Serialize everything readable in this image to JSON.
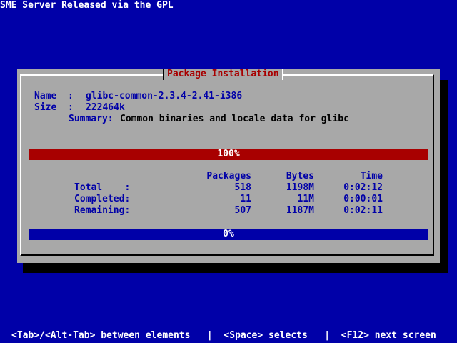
{
  "screen_title": "SME Server Released via the GPL",
  "dialog": {
    "title": "Package Installation",
    "name_label": "Name  :",
    "name_value": "glibc-common-2.3.4-2.41-i386",
    "size_label": "Size  :",
    "size_value": "222464k",
    "summary_label": "Summary:",
    "summary_value": "Common binaries and locale data for glibc",
    "package_progress": {
      "label": "100%",
      "fraction": 1.0
    },
    "stats": {
      "headers": [
        "Packages",
        "Bytes",
        "Time"
      ],
      "rows": [
        {
          "label": "Total    :",
          "packages": "518",
          "bytes": "1198M",
          "time": "0:02:12"
        },
        {
          "label": "Completed:",
          "packages": "11",
          "bytes": "11M",
          "time": "0:00:01"
        },
        {
          "label": "Remaining:",
          "packages": "507",
          "bytes": "1187M",
          "time": "0:02:11"
        }
      ]
    },
    "overall_progress": {
      "label": "0%",
      "fraction": 0.0
    }
  },
  "help_line": "<Tab>/<Alt-Tab> between elements   |  <Space> selects   |  <F12> next screen",
  "colors": {
    "background": "#0000a8",
    "dialog": "#a8a8a8",
    "title": "#a80000",
    "progress_full": "#a80000",
    "progress_empty": "#0000a8"
  }
}
